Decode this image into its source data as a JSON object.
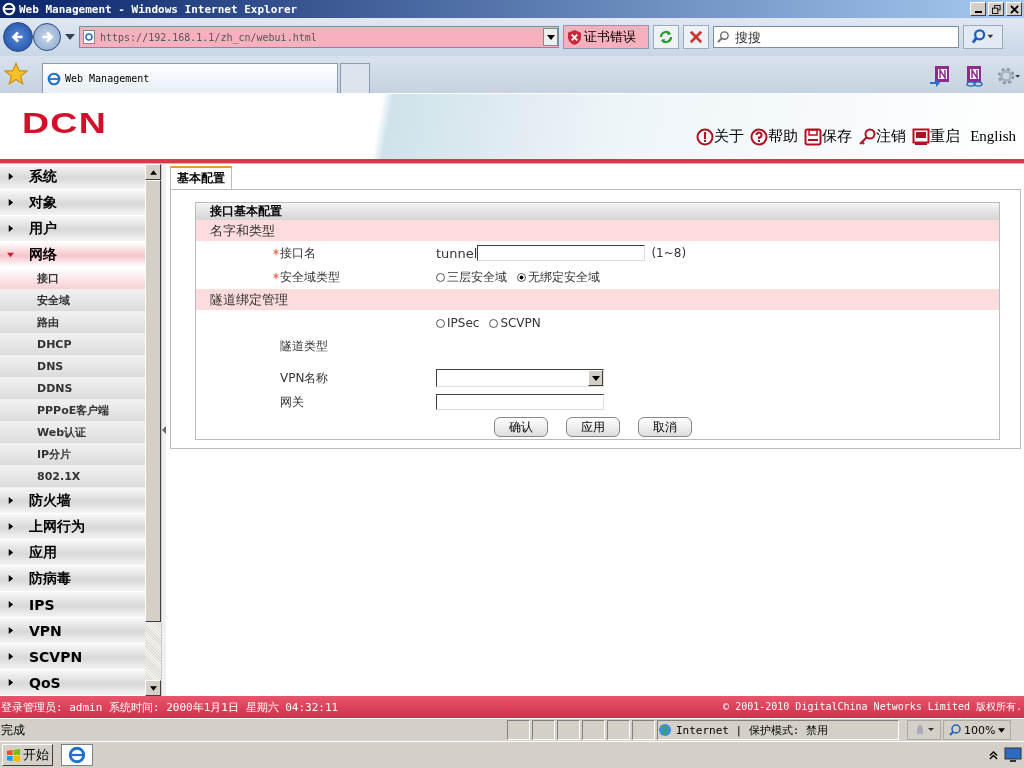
{
  "window": {
    "title": "Web Management - Windows Internet Explorer"
  },
  "browser": {
    "address": "https://192.168.1.1/zh_cn/webui.html",
    "cert_error": "证书错误",
    "search_placeholder": "搜搜",
    "tab_title": "Web Management"
  },
  "header": {
    "logo": "DCN",
    "links": [
      {
        "kind": "info",
        "label": "关于"
      },
      {
        "kind": "help",
        "label": "帮助"
      },
      {
        "kind": "save",
        "label": "保存"
      },
      {
        "kind": "logout",
        "label": "注销"
      },
      {
        "kind": "restart",
        "label": "重启"
      }
    ],
    "language": "English"
  },
  "sidebar": {
    "items": [
      {
        "label": "系统",
        "expanded": false
      },
      {
        "label": "对象",
        "expanded": false
      },
      {
        "label": "用户",
        "expanded": false
      },
      {
        "label": "网络",
        "expanded": true,
        "children": [
          {
            "label": "接口",
            "selected": true
          },
          {
            "label": "安全域",
            "selected": false
          },
          {
            "label": "路由",
            "selected": false
          },
          {
            "label": "DHCP",
            "selected": false
          },
          {
            "label": "DNS",
            "selected": false
          },
          {
            "label": "DDNS",
            "selected": false
          },
          {
            "label": "PPPoE客户端",
            "selected": false
          },
          {
            "label": "Web认证",
            "selected": false
          },
          {
            "label": "IP分片",
            "selected": false
          },
          {
            "label": "802.1X",
            "selected": false
          }
        ]
      },
      {
        "label": "防火墙",
        "expanded": false
      },
      {
        "label": "上网行为",
        "expanded": false
      },
      {
        "label": "应用",
        "expanded": false
      },
      {
        "label": "防病毒",
        "expanded": false
      },
      {
        "label": "IPS",
        "expanded": false
      },
      {
        "label": "VPN",
        "expanded": false
      },
      {
        "label": "SCVPN",
        "expanded": false
      },
      {
        "label": "QoS",
        "expanded": false
      }
    ]
  },
  "content": {
    "tabs": [
      {
        "label": "基本配置",
        "selected": true
      }
    ],
    "panel_title": "接口基本配置",
    "sections": [
      {
        "title": "名字和类型",
        "rows": [
          {
            "kind": "text",
            "label": "接口名",
            "required": true,
            "prefix": "tunnel",
            "hint": "(1~8)"
          },
          {
            "kind": "radio",
            "label": "安全域类型",
            "required": true,
            "options": [
              {
                "label": "三层安全域",
                "selected": false
              },
              {
                "label": "无绑定安全域",
                "selected": true
              }
            ]
          }
        ]
      },
      {
        "title": "隧道绑定管理",
        "rows": [
          {
            "kind": "radio-tall",
            "label": "隧道类型",
            "required": false,
            "options": [
              {
                "label": "IPSec",
                "selected": false
              },
              {
                "label": "SCVPN",
                "selected": false
              }
            ]
          },
          {
            "kind": "select",
            "label": "VPN名称",
            "required": false
          },
          {
            "kind": "text",
            "label": "网关",
            "required": false
          }
        ]
      }
    ],
    "buttons": [
      "确认",
      "应用",
      "取消"
    ]
  },
  "footer": {
    "login": "登录管理员: admin 系统时间: 2000年1月1日 星期六 04:32:11",
    "copyright": "© 2001-2010 DigitalChina Networks Limited 版权所有."
  },
  "status_bar": {
    "status": "完成",
    "zone": "Internet | 保护模式: 禁用",
    "zoom": "100%"
  },
  "taskbar": {
    "start": "开始"
  }
}
